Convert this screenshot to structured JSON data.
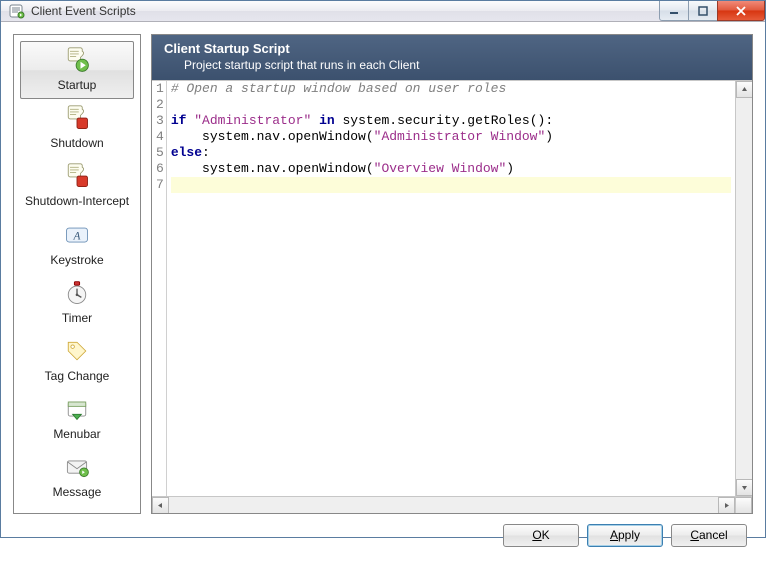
{
  "window": {
    "title": "Client Event Scripts"
  },
  "sidebar": {
    "items": [
      {
        "label": "Startup",
        "icon": "script-play-icon",
        "selected": true
      },
      {
        "label": "Shutdown",
        "icon": "script-stop-icon",
        "selected": false
      },
      {
        "label": "Shutdown-Intercept",
        "icon": "script-stop-icon",
        "selected": false
      },
      {
        "label": "Keystroke",
        "icon": "keystroke-icon",
        "selected": false
      },
      {
        "label": "Timer",
        "icon": "timer-icon",
        "selected": false
      },
      {
        "label": "Tag Change",
        "icon": "tag-icon",
        "selected": false
      },
      {
        "label": "Menubar",
        "icon": "menubar-icon",
        "selected": false
      },
      {
        "label": "Message",
        "icon": "message-icon",
        "selected": false
      }
    ]
  },
  "header": {
    "title": "Client Startup Script",
    "subtitle": "Project startup script that runs in each Client"
  },
  "editor": {
    "lines": [
      {
        "n": 1,
        "tokens": [
          {
            "t": "# Open a startup window based on user roles",
            "c": "tok-comment"
          }
        ]
      },
      {
        "n": 2,
        "tokens": []
      },
      {
        "n": 3,
        "tokens": [
          {
            "t": "if",
            "c": "tok-kw"
          },
          {
            "t": " ",
            "c": "tok-ident"
          },
          {
            "t": "\"Administrator\"",
            "c": "tok-str"
          },
          {
            "t": " ",
            "c": "tok-ident"
          },
          {
            "t": "in",
            "c": "tok-kw"
          },
          {
            "t": " system.security.getRoles():",
            "c": "tok-ident"
          }
        ]
      },
      {
        "n": 4,
        "tokens": [
          {
            "t": "    system.nav.openWindow(",
            "c": "tok-ident"
          },
          {
            "t": "\"Administrator Window\"",
            "c": "tok-str"
          },
          {
            "t": ")",
            "c": "tok-ident"
          }
        ]
      },
      {
        "n": 5,
        "tokens": [
          {
            "t": "else",
            "c": "tok-kw"
          },
          {
            "t": ":",
            "c": "tok-ident"
          }
        ]
      },
      {
        "n": 6,
        "tokens": [
          {
            "t": "    system.nav.openWindow(",
            "c": "tok-ident"
          },
          {
            "t": "\"Overview Window\"",
            "c": "tok-str"
          },
          {
            "t": ")",
            "c": "tok-ident"
          }
        ]
      },
      {
        "n": 7,
        "tokens": [],
        "current": true
      }
    ]
  },
  "buttons": {
    "ok": {
      "pre": "",
      "u": "O",
      "post": "K"
    },
    "apply": {
      "pre": "",
      "u": "A",
      "post": "pply"
    },
    "cancel": {
      "pre": "",
      "u": "C",
      "post": "ancel"
    }
  }
}
